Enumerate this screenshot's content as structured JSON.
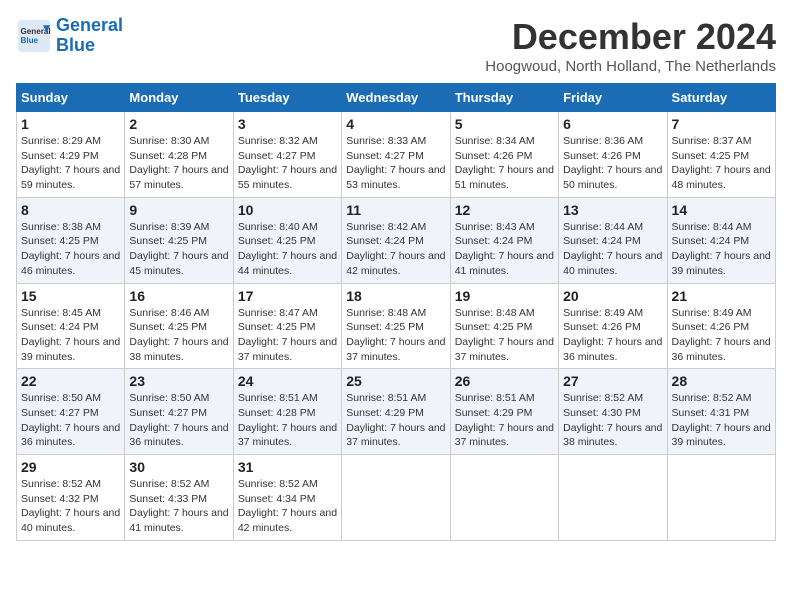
{
  "logo": {
    "line1": "General",
    "line2": "Blue"
  },
  "title": "December 2024",
  "subtitle": "Hoogwoud, North Holland, The Netherlands",
  "weekdays": [
    "Sunday",
    "Monday",
    "Tuesday",
    "Wednesday",
    "Thursday",
    "Friday",
    "Saturday"
  ],
  "weeks": [
    [
      {
        "day": "1",
        "sunrise": "8:29 AM",
        "sunset": "4:29 PM",
        "daylight": "7 hours and 59 minutes."
      },
      {
        "day": "2",
        "sunrise": "8:30 AM",
        "sunset": "4:28 PM",
        "daylight": "7 hours and 57 minutes."
      },
      {
        "day": "3",
        "sunrise": "8:32 AM",
        "sunset": "4:27 PM",
        "daylight": "7 hours and 55 minutes."
      },
      {
        "day": "4",
        "sunrise": "8:33 AM",
        "sunset": "4:27 PM",
        "daylight": "7 hours and 53 minutes."
      },
      {
        "day": "5",
        "sunrise": "8:34 AM",
        "sunset": "4:26 PM",
        "daylight": "7 hours and 51 minutes."
      },
      {
        "day": "6",
        "sunrise": "8:36 AM",
        "sunset": "4:26 PM",
        "daylight": "7 hours and 50 minutes."
      },
      {
        "day": "7",
        "sunrise": "8:37 AM",
        "sunset": "4:25 PM",
        "daylight": "7 hours and 48 minutes."
      }
    ],
    [
      {
        "day": "8",
        "sunrise": "8:38 AM",
        "sunset": "4:25 PM",
        "daylight": "7 hours and 46 minutes."
      },
      {
        "day": "9",
        "sunrise": "8:39 AM",
        "sunset": "4:25 PM",
        "daylight": "7 hours and 45 minutes."
      },
      {
        "day": "10",
        "sunrise": "8:40 AM",
        "sunset": "4:25 PM",
        "daylight": "7 hours and 44 minutes."
      },
      {
        "day": "11",
        "sunrise": "8:42 AM",
        "sunset": "4:24 PM",
        "daylight": "7 hours and 42 minutes."
      },
      {
        "day": "12",
        "sunrise": "8:43 AM",
        "sunset": "4:24 PM",
        "daylight": "7 hours and 41 minutes."
      },
      {
        "day": "13",
        "sunrise": "8:44 AM",
        "sunset": "4:24 PM",
        "daylight": "7 hours and 40 minutes."
      },
      {
        "day": "14",
        "sunrise": "8:44 AM",
        "sunset": "4:24 PM",
        "daylight": "7 hours and 39 minutes."
      }
    ],
    [
      {
        "day": "15",
        "sunrise": "8:45 AM",
        "sunset": "4:24 PM",
        "daylight": "7 hours and 39 minutes."
      },
      {
        "day": "16",
        "sunrise": "8:46 AM",
        "sunset": "4:25 PM",
        "daylight": "7 hours and 38 minutes."
      },
      {
        "day": "17",
        "sunrise": "8:47 AM",
        "sunset": "4:25 PM",
        "daylight": "7 hours and 37 minutes."
      },
      {
        "day": "18",
        "sunrise": "8:48 AM",
        "sunset": "4:25 PM",
        "daylight": "7 hours and 37 minutes."
      },
      {
        "day": "19",
        "sunrise": "8:48 AM",
        "sunset": "4:25 PM",
        "daylight": "7 hours and 37 minutes."
      },
      {
        "day": "20",
        "sunrise": "8:49 AM",
        "sunset": "4:26 PM",
        "daylight": "7 hours and 36 minutes."
      },
      {
        "day": "21",
        "sunrise": "8:49 AM",
        "sunset": "4:26 PM",
        "daylight": "7 hours and 36 minutes."
      }
    ],
    [
      {
        "day": "22",
        "sunrise": "8:50 AM",
        "sunset": "4:27 PM",
        "daylight": "7 hours and 36 minutes."
      },
      {
        "day": "23",
        "sunrise": "8:50 AM",
        "sunset": "4:27 PM",
        "daylight": "7 hours and 36 minutes."
      },
      {
        "day": "24",
        "sunrise": "8:51 AM",
        "sunset": "4:28 PM",
        "daylight": "7 hours and 37 minutes."
      },
      {
        "day": "25",
        "sunrise": "8:51 AM",
        "sunset": "4:29 PM",
        "daylight": "7 hours and 37 minutes."
      },
      {
        "day": "26",
        "sunrise": "8:51 AM",
        "sunset": "4:29 PM",
        "daylight": "7 hours and 37 minutes."
      },
      {
        "day": "27",
        "sunrise": "8:52 AM",
        "sunset": "4:30 PM",
        "daylight": "7 hours and 38 minutes."
      },
      {
        "day": "28",
        "sunrise": "8:52 AM",
        "sunset": "4:31 PM",
        "daylight": "7 hours and 39 minutes."
      }
    ],
    [
      {
        "day": "29",
        "sunrise": "8:52 AM",
        "sunset": "4:32 PM",
        "daylight": "7 hours and 40 minutes."
      },
      {
        "day": "30",
        "sunrise": "8:52 AM",
        "sunset": "4:33 PM",
        "daylight": "7 hours and 41 minutes."
      },
      {
        "day": "31",
        "sunrise": "8:52 AM",
        "sunset": "4:34 PM",
        "daylight": "7 hours and 42 minutes."
      },
      null,
      null,
      null,
      null
    ]
  ]
}
